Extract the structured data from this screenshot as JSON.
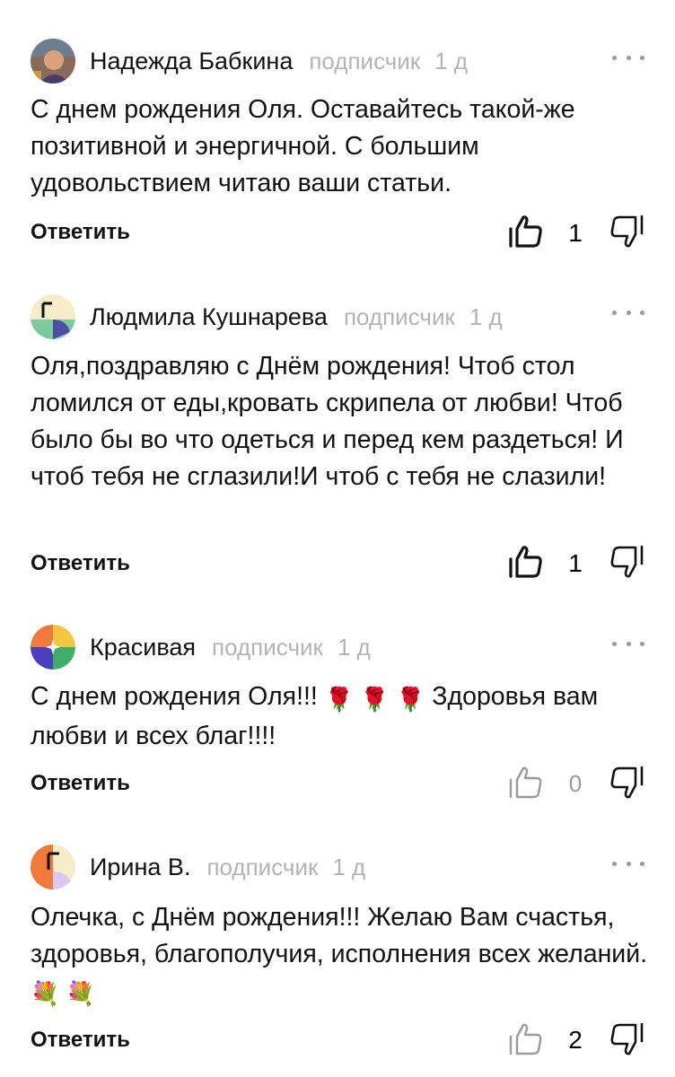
{
  "comments": [
    {
      "author": "Надежда Бабкина",
      "role": "подписчик",
      "age": "1 д",
      "text": "С днем рождения Оля. Оставайтесь такой-же позитивной и энергичной. С большим удовольствием читаю ваши статьи.",
      "reply_label": "Ответить",
      "likes": "1"
    },
    {
      "author": "Людмила Кушнарева",
      "role": "подписчик",
      "age": "1 д",
      "text": "Оля,поздравляю с Днём рождения! Чтоб стол ломился от еды,кровать скрипела от любви! Чтоб было бы во что одеться и перед кем раздеться! И чтоб тебя не сглазили!И чтоб с тебя не слазили!",
      "reply_label": "Ответить",
      "likes": "1"
    },
    {
      "author": "Красивая",
      "role": "подписчик",
      "age": "1 д",
      "text_start": "С днем рождения Оля!!! ",
      "emoji": "🌹 🌹 🌹",
      "text_end": "Здоровья вам любви и всех благ!!!!",
      "reply_label": "Ответить",
      "likes": "0"
    },
    {
      "author": "Ирина В.",
      "role": "подписчик",
      "age": "1 д",
      "text": "Олечка, с Днём рождения!!! Желаю Вам счастья, здоровья, благополучия, исполнения всех желаний. ",
      "emoji": "💐 💐",
      "reply_label": "Ответить",
      "likes": "2"
    }
  ],
  "icons": {
    "more": "more-dots-icon",
    "like": "thumbs-up-icon",
    "dislike": "thumbs-down-icon"
  },
  "colors": {
    "meta": "#b3b3b3",
    "text": "#111111"
  }
}
